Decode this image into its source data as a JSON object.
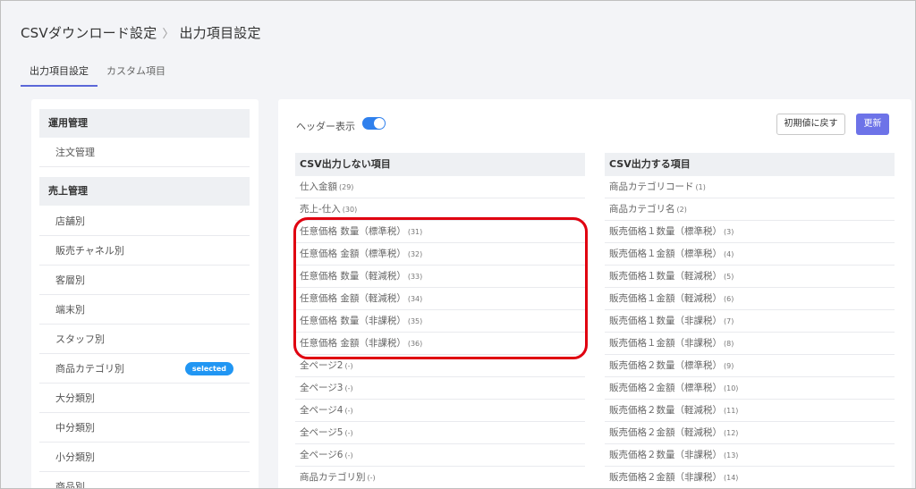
{
  "breadcrumb": {
    "parent": "CSVダウンロード設定",
    "separator": "〉",
    "current": "出力項目設定"
  },
  "tabs": [
    {
      "label": "出力項目設定"
    },
    {
      "label": "カスタム項目"
    }
  ],
  "sidebar": {
    "groups": [
      {
        "title": "運用管理",
        "items": [
          "注文管理"
        ]
      },
      {
        "title": "売上管理",
        "items": [
          "店舗別",
          "販売チャネル別",
          "客層別",
          "端末別",
          "スタッフ別",
          "商品カテゴリ別",
          "大分類別",
          "中分類別",
          "小分類別",
          "商品別"
        ]
      }
    ],
    "selected_badge": "selected"
  },
  "main": {
    "header_display_label": "ヘッダー表示",
    "header_display_on": true,
    "reset_label": "初期値に戻す",
    "update_label": "更新",
    "left_column": {
      "title": "CSV出力しない項目",
      "rows": [
        {
          "label": "仕入金額",
          "num": "(29)"
        },
        {
          "label": "売上-仕入",
          "num": "(30)"
        },
        {
          "label": "任意価格 数量（標準税）",
          "num": "(31)"
        },
        {
          "label": "任意価格 金額（標準税）",
          "num": "(32)"
        },
        {
          "label": "任意価格 数量（軽減税）",
          "num": "(33)"
        },
        {
          "label": "任意価格 金額（軽減税）",
          "num": "(34)"
        },
        {
          "label": "任意価格 数量（非課税）",
          "num": "(35)"
        },
        {
          "label": "任意価格 金額（非課税）",
          "num": "(36)"
        },
        {
          "label": "全ページ2",
          "num": "(-)"
        },
        {
          "label": "全ページ3",
          "num": "(-)"
        },
        {
          "label": "全ページ4",
          "num": "(-)"
        },
        {
          "label": "全ページ5",
          "num": "(-)"
        },
        {
          "label": "全ページ6",
          "num": "(-)"
        },
        {
          "label": "商品カテゴリ別",
          "num": "(-)"
        }
      ]
    },
    "right_column": {
      "title": "CSV出力する項目",
      "rows": [
        {
          "label": "商品カテゴリコード",
          "num": "(1)"
        },
        {
          "label": "商品カテゴリ名",
          "num": "(2)"
        },
        {
          "label": "販売価格１数量（標準税）",
          "num": "(3)"
        },
        {
          "label": "販売価格１金額（標準税）",
          "num": "(4)"
        },
        {
          "label": "販売価格１数量（軽減税）",
          "num": "(5)"
        },
        {
          "label": "販売価格１金額（軽減税）",
          "num": "(6)"
        },
        {
          "label": "販売価格１数量（非課税）",
          "num": "(7)"
        },
        {
          "label": "販売価格１金額（非課税）",
          "num": "(8)"
        },
        {
          "label": "販売価格２数量（標準税）",
          "num": "(9)"
        },
        {
          "label": "販売価格２金額（標準税）",
          "num": "(10)"
        },
        {
          "label": "販売価格２数量（軽減税）",
          "num": "(11)"
        },
        {
          "label": "販売価格２金額（軽減税）",
          "num": "(12)"
        },
        {
          "label": "販売価格２数量（非課税）",
          "num": "(13)"
        },
        {
          "label": "販売価格２金額（非課税）",
          "num": "(14)"
        }
      ]
    }
  },
  "colors": {
    "accent": "#5b67d8",
    "toggle": "#2f80ed",
    "update_button": "#6d73e8",
    "badge": "#2196f3",
    "highlight": "#e00010"
  }
}
